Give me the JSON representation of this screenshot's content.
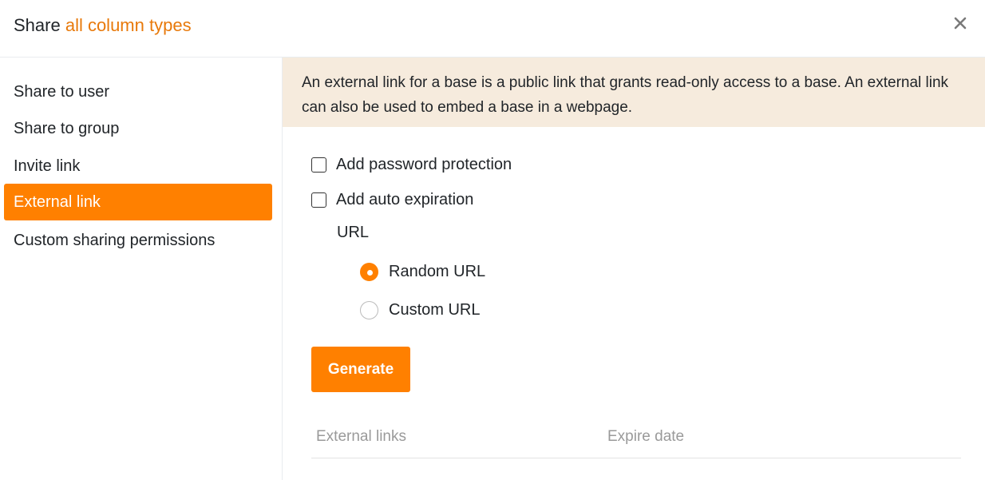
{
  "header": {
    "title_prefix": "Share ",
    "title_accent": "all column types",
    "close_icon": "close-icon"
  },
  "sidebar": {
    "items": [
      {
        "label": "Share to user"
      },
      {
        "label": "Share to group"
      },
      {
        "label": "Invite link"
      },
      {
        "label": "External link",
        "active": true
      },
      {
        "label": "Custom sharing permissions"
      }
    ]
  },
  "main": {
    "notice": "An external link for a base is a public link that grants read-only access to a base. An external link can also be used to embed a base in a webpage.",
    "options": {
      "password_protection": "Add password protection",
      "auto_expiration": "Add auto expiration"
    },
    "url_label": "URL",
    "url_options": {
      "random": "Random URL",
      "custom": "Custom URL",
      "selected": "Random URL"
    },
    "generate_label": "Generate",
    "table": {
      "columns": [
        "External links",
        "Expire date"
      ]
    }
  },
  "colors": {
    "accent": "#ff8000",
    "title_accent": "#e8790a",
    "notice_bg": "#f6ebdd"
  }
}
